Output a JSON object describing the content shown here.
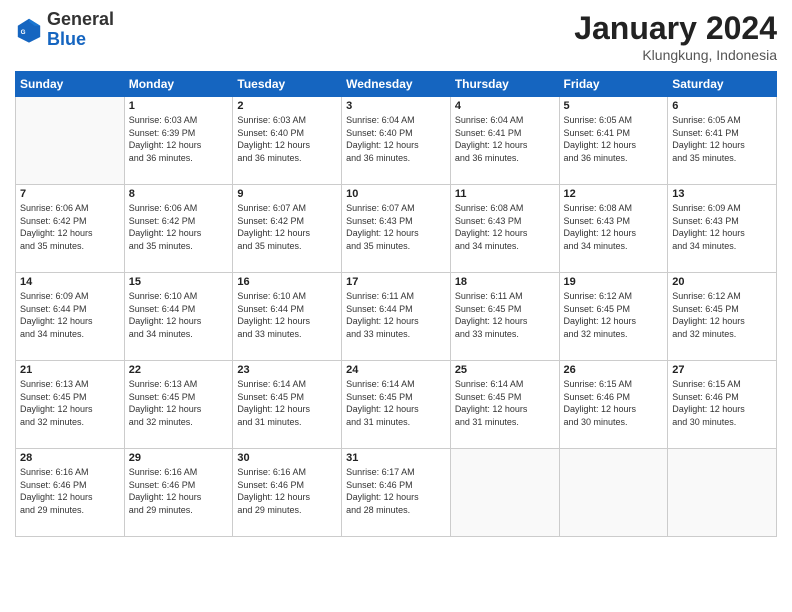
{
  "header": {
    "logo_line1": "General",
    "logo_line2": "Blue",
    "month_year": "January 2024",
    "location": "Klungkung, Indonesia"
  },
  "weekdays": [
    "Sunday",
    "Monday",
    "Tuesday",
    "Wednesday",
    "Thursday",
    "Friday",
    "Saturday"
  ],
  "weeks": [
    [
      {
        "day": "",
        "sunrise": "",
        "sunset": "",
        "daylight": ""
      },
      {
        "day": "1",
        "sunrise": "6:03 AM",
        "sunset": "6:39 PM",
        "daylight": "12 hours and 36 minutes."
      },
      {
        "day": "2",
        "sunrise": "6:03 AM",
        "sunset": "6:40 PM",
        "daylight": "12 hours and 36 minutes."
      },
      {
        "day": "3",
        "sunrise": "6:04 AM",
        "sunset": "6:40 PM",
        "daylight": "12 hours and 36 minutes."
      },
      {
        "day": "4",
        "sunrise": "6:04 AM",
        "sunset": "6:41 PM",
        "daylight": "12 hours and 36 minutes."
      },
      {
        "day": "5",
        "sunrise": "6:05 AM",
        "sunset": "6:41 PM",
        "daylight": "12 hours and 36 minutes."
      },
      {
        "day": "6",
        "sunrise": "6:05 AM",
        "sunset": "6:41 PM",
        "daylight": "12 hours and 35 minutes."
      }
    ],
    [
      {
        "day": "7",
        "sunrise": "6:06 AM",
        "sunset": "6:42 PM",
        "daylight": "12 hours and 35 minutes."
      },
      {
        "day": "8",
        "sunrise": "6:06 AM",
        "sunset": "6:42 PM",
        "daylight": "12 hours and 35 minutes."
      },
      {
        "day": "9",
        "sunrise": "6:07 AM",
        "sunset": "6:42 PM",
        "daylight": "12 hours and 35 minutes."
      },
      {
        "day": "10",
        "sunrise": "6:07 AM",
        "sunset": "6:43 PM",
        "daylight": "12 hours and 35 minutes."
      },
      {
        "day": "11",
        "sunrise": "6:08 AM",
        "sunset": "6:43 PM",
        "daylight": "12 hours and 34 minutes."
      },
      {
        "day": "12",
        "sunrise": "6:08 AM",
        "sunset": "6:43 PM",
        "daylight": "12 hours and 34 minutes."
      },
      {
        "day": "13",
        "sunrise": "6:09 AM",
        "sunset": "6:43 PM",
        "daylight": "12 hours and 34 minutes."
      }
    ],
    [
      {
        "day": "14",
        "sunrise": "6:09 AM",
        "sunset": "6:44 PM",
        "daylight": "12 hours and 34 minutes."
      },
      {
        "day": "15",
        "sunrise": "6:10 AM",
        "sunset": "6:44 PM",
        "daylight": "12 hours and 34 minutes."
      },
      {
        "day": "16",
        "sunrise": "6:10 AM",
        "sunset": "6:44 PM",
        "daylight": "12 hours and 33 minutes."
      },
      {
        "day": "17",
        "sunrise": "6:11 AM",
        "sunset": "6:44 PM",
        "daylight": "12 hours and 33 minutes."
      },
      {
        "day": "18",
        "sunrise": "6:11 AM",
        "sunset": "6:45 PM",
        "daylight": "12 hours and 33 minutes."
      },
      {
        "day": "19",
        "sunrise": "6:12 AM",
        "sunset": "6:45 PM",
        "daylight": "12 hours and 32 minutes."
      },
      {
        "day": "20",
        "sunrise": "6:12 AM",
        "sunset": "6:45 PM",
        "daylight": "12 hours and 32 minutes."
      }
    ],
    [
      {
        "day": "21",
        "sunrise": "6:13 AM",
        "sunset": "6:45 PM",
        "daylight": "12 hours and 32 minutes."
      },
      {
        "day": "22",
        "sunrise": "6:13 AM",
        "sunset": "6:45 PM",
        "daylight": "12 hours and 32 minutes."
      },
      {
        "day": "23",
        "sunrise": "6:14 AM",
        "sunset": "6:45 PM",
        "daylight": "12 hours and 31 minutes."
      },
      {
        "day": "24",
        "sunrise": "6:14 AM",
        "sunset": "6:45 PM",
        "daylight": "12 hours and 31 minutes."
      },
      {
        "day": "25",
        "sunrise": "6:14 AM",
        "sunset": "6:45 PM",
        "daylight": "12 hours and 31 minutes."
      },
      {
        "day": "26",
        "sunrise": "6:15 AM",
        "sunset": "6:46 PM",
        "daylight": "12 hours and 30 minutes."
      },
      {
        "day": "27",
        "sunrise": "6:15 AM",
        "sunset": "6:46 PM",
        "daylight": "12 hours and 30 minutes."
      }
    ],
    [
      {
        "day": "28",
        "sunrise": "6:16 AM",
        "sunset": "6:46 PM",
        "daylight": "12 hours and 29 minutes."
      },
      {
        "day": "29",
        "sunrise": "6:16 AM",
        "sunset": "6:46 PM",
        "daylight": "12 hours and 29 minutes."
      },
      {
        "day": "30",
        "sunrise": "6:16 AM",
        "sunset": "6:46 PM",
        "daylight": "12 hours and 29 minutes."
      },
      {
        "day": "31",
        "sunrise": "6:17 AM",
        "sunset": "6:46 PM",
        "daylight": "12 hours and 28 minutes."
      },
      {
        "day": "",
        "sunrise": "",
        "sunset": "",
        "daylight": ""
      },
      {
        "day": "",
        "sunrise": "",
        "sunset": "",
        "daylight": ""
      },
      {
        "day": "",
        "sunrise": "",
        "sunset": "",
        "daylight": ""
      }
    ]
  ],
  "labels": {
    "sunrise_prefix": "Sunrise: ",
    "sunset_prefix": "Sunset: ",
    "daylight_prefix": "Daylight: "
  }
}
